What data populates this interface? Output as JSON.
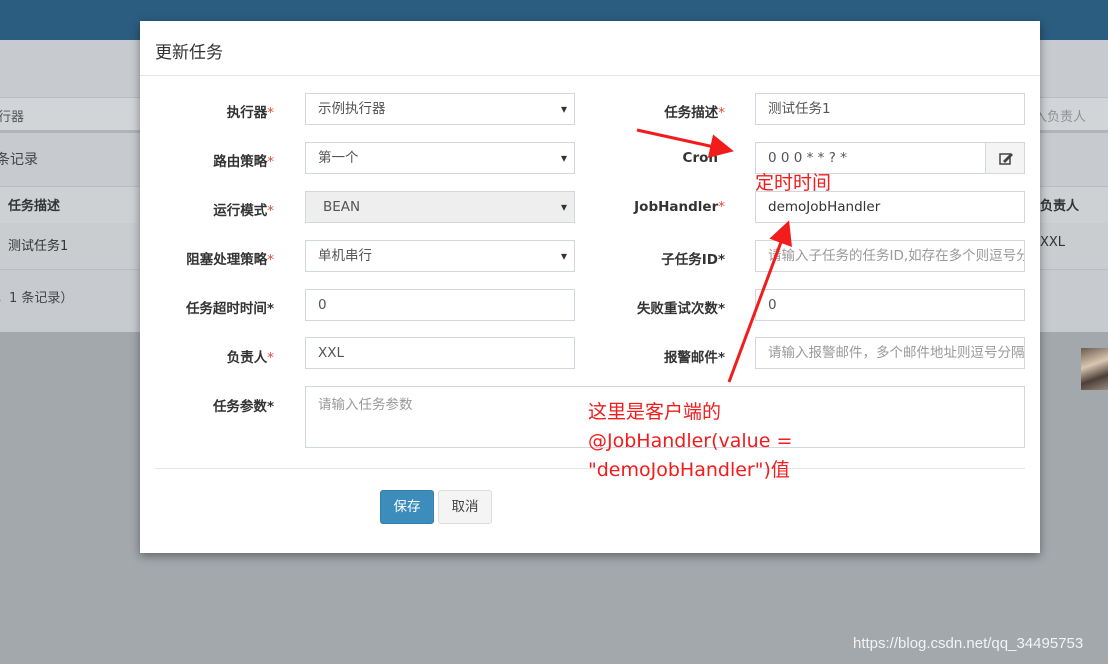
{
  "background": {
    "filter_left": "行器",
    "filter_right": "入负责人",
    "record_count": "条记录",
    "table_header_desc": "任务描述",
    "table_header_owner": "负责人",
    "row_desc": "测试任务1",
    "row_owner": "XXL",
    "footer_text": "，1 条记录）"
  },
  "modal": {
    "title": "更新任务",
    "fields": {
      "executor": {
        "label": "执行器",
        "value": "示例执行器"
      },
      "task_desc": {
        "label": "任务描述",
        "value": "测试任务1"
      },
      "route_strategy": {
        "label": "路由策略",
        "value": "第一个"
      },
      "cron": {
        "label": "Cron",
        "value": "0 0 0 * * ? *"
      },
      "run_mode": {
        "label": "运行模式",
        "value": "BEAN"
      },
      "job_handler": {
        "label": "JobHandler",
        "value": "demoJobHandler"
      },
      "block_strategy": {
        "label": "阻塞处理策略",
        "value": "单机串行"
      },
      "child_job_id": {
        "label": "子任务ID",
        "placeholder": "请输入子任务的任务ID,如存在多个则逗号分隔"
      },
      "timeout": {
        "label": "任务超时时间",
        "value": "0"
      },
      "retry_count": {
        "label": "失败重试次数",
        "value": "0"
      },
      "owner": {
        "label": "负责人",
        "value": "XXL"
      },
      "alarm_email": {
        "label": "报警邮件",
        "placeholder": "请输入报警邮件，多个邮件地址则逗号分隔"
      },
      "task_param": {
        "label": "任务参数",
        "placeholder": "请输入任务参数"
      }
    },
    "required_mark": "*",
    "save_label": "保存",
    "cancel_label": "取消"
  },
  "annotations": {
    "cron_note": "定时时间",
    "handler_note_1": "这里是客户端的",
    "handler_note_2": "@JobHandler(value =",
    "handler_note_3": "\"demoJobHandler\")值"
  },
  "watermark": "https://blog.csdn.net/qq_34495753",
  "colors": {
    "accent": "#3c8dbc",
    "annotation": "#f21c1c",
    "required": "#dd4b39",
    "topbar": "#2b5d80"
  }
}
